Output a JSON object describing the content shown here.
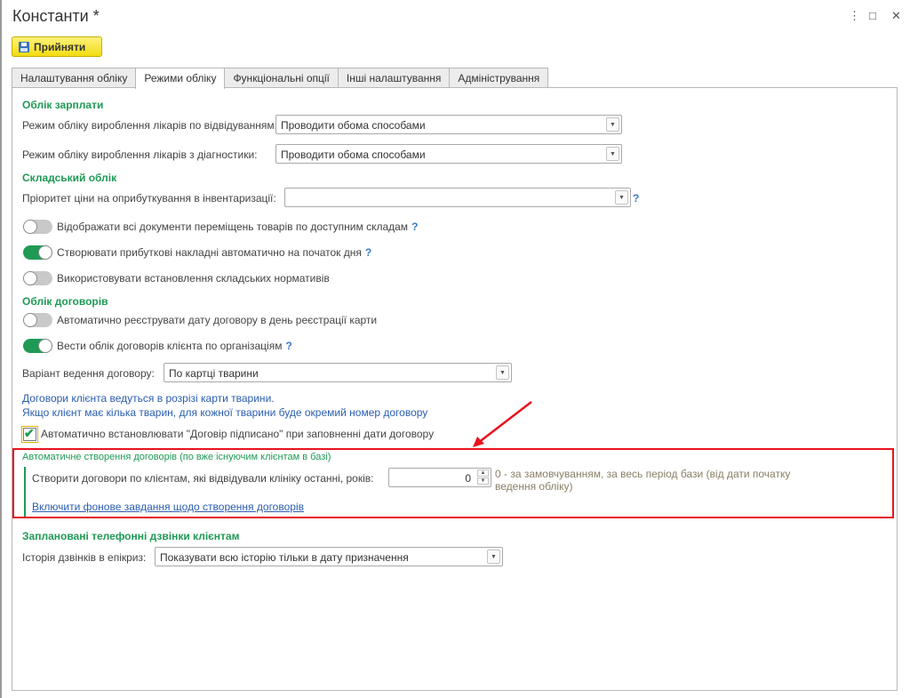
{
  "window": {
    "title": "Константи *",
    "more_icon": "⋮",
    "maximize_icon": "□",
    "close_icon": "✕"
  },
  "toolbar": {
    "apply_label": "Прийняти"
  },
  "tabs": [
    {
      "label": "Налаштування обліку",
      "active": false
    },
    {
      "label": "Режими обліку",
      "active": true
    },
    {
      "label": "Функціональні опції",
      "active": false
    },
    {
      "label": "Інші налаштування",
      "active": false
    },
    {
      "label": "Адміністрування",
      "active": false
    }
  ],
  "salary": {
    "title": "Облік зарплати",
    "visits_label": "Режим обліку вироблення лікарів по відвідуванням:",
    "visits_value": "Проводити обома способами",
    "diagnostics_label": "Режим обліку вироблення лікарів з діагностики:",
    "diagnostics_value": "Проводити обома способами"
  },
  "warehouse": {
    "title": "Складський облік",
    "priority_label": "Пріоритет ціни на оприбуткування в інвентаризації:",
    "priority_value": "",
    "help": "?",
    "toggles": [
      {
        "label": "Відображати всі документи переміщень товарів по доступним складам",
        "on": false,
        "help": "?"
      },
      {
        "label": "Створювати прибуткові накладні автоматично на початок дня",
        "on": true,
        "help": "?"
      },
      {
        "label": "Використовувати встановлення складських нормативів",
        "on": false,
        "help": ""
      }
    ]
  },
  "contracts": {
    "title": "Облік договорів",
    "toggles": [
      {
        "label": "Автоматично реєструвати дату договору в день реєстрації карти",
        "on": false,
        "help": ""
      },
      {
        "label": "Вести облік договорів клієнта по організаціям",
        "on": true,
        "help": "?"
      }
    ],
    "variant_label": "Варіант ведення договору:",
    "variant_value": "По картці тварини",
    "note_line1": "Договори клієнта ведуться в розрізі карти тварини.",
    "note_line2": "Якщо клієнт має кілька тварин, для кожної тварини буде окремий номер договору",
    "signed_checkbox_label": "Автоматично встановлювати \"Договір підписано\" при заповненні дати договору",
    "signed_checked": true
  },
  "auto_creation": {
    "group_title": "Автоматичне створення договорів (по вже існуючим клієнтам в базі)",
    "years_label": "Створити договори по клієнтам, які відвідували клініку останні, років:",
    "years_value": "0",
    "hint_line1": "0 - за замовчуванням, за весь період бази (від дати початку",
    "hint_line2": "ведення обліку)",
    "link": "Включити фонове завдання щодо створення договорів"
  },
  "calls": {
    "title": "Заплановані телефонні дзвінки клієнтам",
    "history_label": "Історія дзвінків в епікриз:",
    "history_value": "Показувати всю історію тільки в дату призначення"
  },
  "colors": {
    "accent_green": "#1f9a55",
    "button_yellow": "#f2dc12",
    "link_blue": "#2a5db0",
    "highlight_red": "#e8131e"
  }
}
